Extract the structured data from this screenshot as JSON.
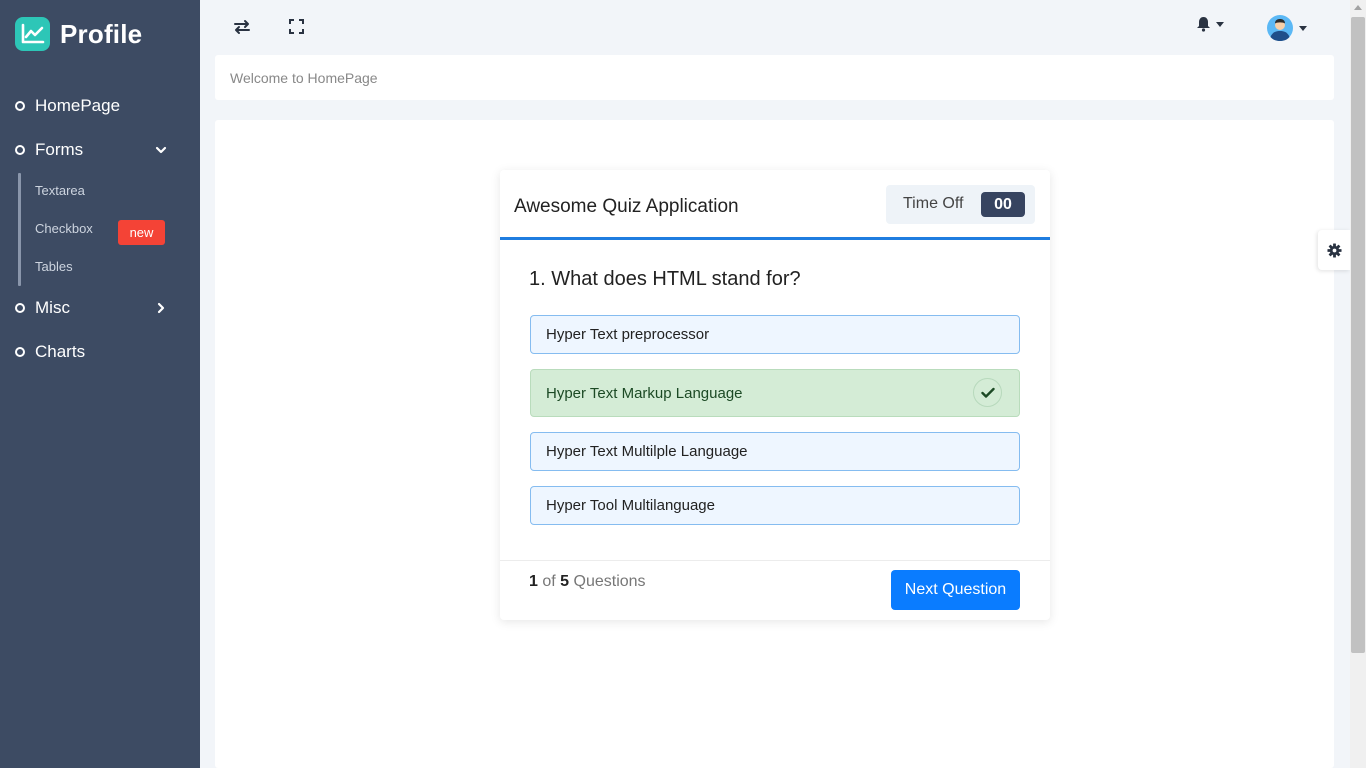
{
  "sidebar": {
    "brand": "Profile",
    "items": [
      {
        "label": "HomePage"
      },
      {
        "label": "Forms"
      },
      {
        "label": "Misc"
      },
      {
        "label": "Charts"
      }
    ],
    "sub_items": [
      {
        "label": "Textarea"
      },
      {
        "label": "Checkbox",
        "badge": "new"
      },
      {
        "label": "Tables"
      }
    ]
  },
  "topbar": {
    "icons": [
      "swap-icon",
      "fullscreen-icon",
      "bell-icon",
      "avatar"
    ]
  },
  "welcome": {
    "text": "Welcome to HomePage"
  },
  "quiz": {
    "title": "Awesome Quiz Application",
    "timer_label": "Time Off",
    "timer_value": "00",
    "question": "1. What does HTML stand for?",
    "options": [
      {
        "text": "Hyper Text preprocessor",
        "correct": false
      },
      {
        "text": "Hyper Text Markup Language",
        "correct": true
      },
      {
        "text": "Hyper Text Multilple Language",
        "correct": false
      },
      {
        "text": "Hyper Tool Multilanguage",
        "correct": false
      }
    ],
    "progress": {
      "current": "1",
      "of": "of",
      "total": "5",
      "label": "Questions"
    },
    "next_label": "Next Question"
  },
  "colors": {
    "sidebar_bg": "#3d4b63",
    "brand_logo": "#2dc6b7",
    "accent": "#0a7cff",
    "badge": "#f44336",
    "correct_bg": "#d4ecd6"
  }
}
